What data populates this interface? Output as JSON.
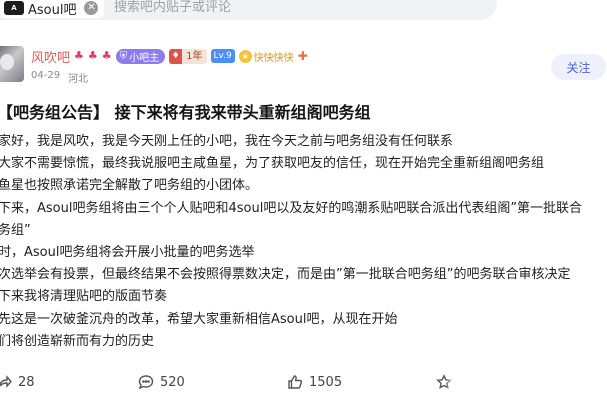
{
  "search": {
    "tag_label": "Asoul吧",
    "placeholder": "搜索吧内贴子或评论"
  },
  "author": {
    "name": "风吹吧",
    "role_badge": "小吧主",
    "year_badge": "1年",
    "level_badge": "Lv.9",
    "happy_badge": "快快快快",
    "date": "04-29",
    "location": "河北",
    "follow_label": "关注"
  },
  "post": {
    "title": "【吧务组公告】 接下来将有我来带头重新组阁吧务组",
    "lines": [
      "家好，我是风吹，我是今天刚上任的小吧，我在今天之前与吧务组没有任何联系",
      "大家不需要惊慌，最终我说服吧主咸鱼星，为了获取吧友的信任，现在开始完全重新组阁吧务组",
      "鱼星也按照承诺完全解散了吧务组的小团体。",
      "下来，Asoul吧务组将由三个个人贴吧和4soul吧以及友好的鸣潮系贴吧联合派出代表组阁”第一批联合",
      "务组”",
      "时，Asoul吧务组将会开展小批量的吧务选举",
      "次选举会有投票，但最终结果不会按照得票数决定，而是由”第一批联合吧务组”的吧务联合审核决定",
      "下来我将清理贴吧的版面节奏",
      "先这是一次破釜沉舟的改革，希望大家重新相信Asoul吧，从现在开始",
      "们将创造崭新而有力的历史"
    ]
  },
  "actions": {
    "share_count": "28",
    "comment_count": "520",
    "like_count": "1505"
  },
  "icons": {
    "share": "share-icon",
    "comment": "comment-icon",
    "like": "thumbs-up-icon",
    "favorite": "star-icon"
  }
}
